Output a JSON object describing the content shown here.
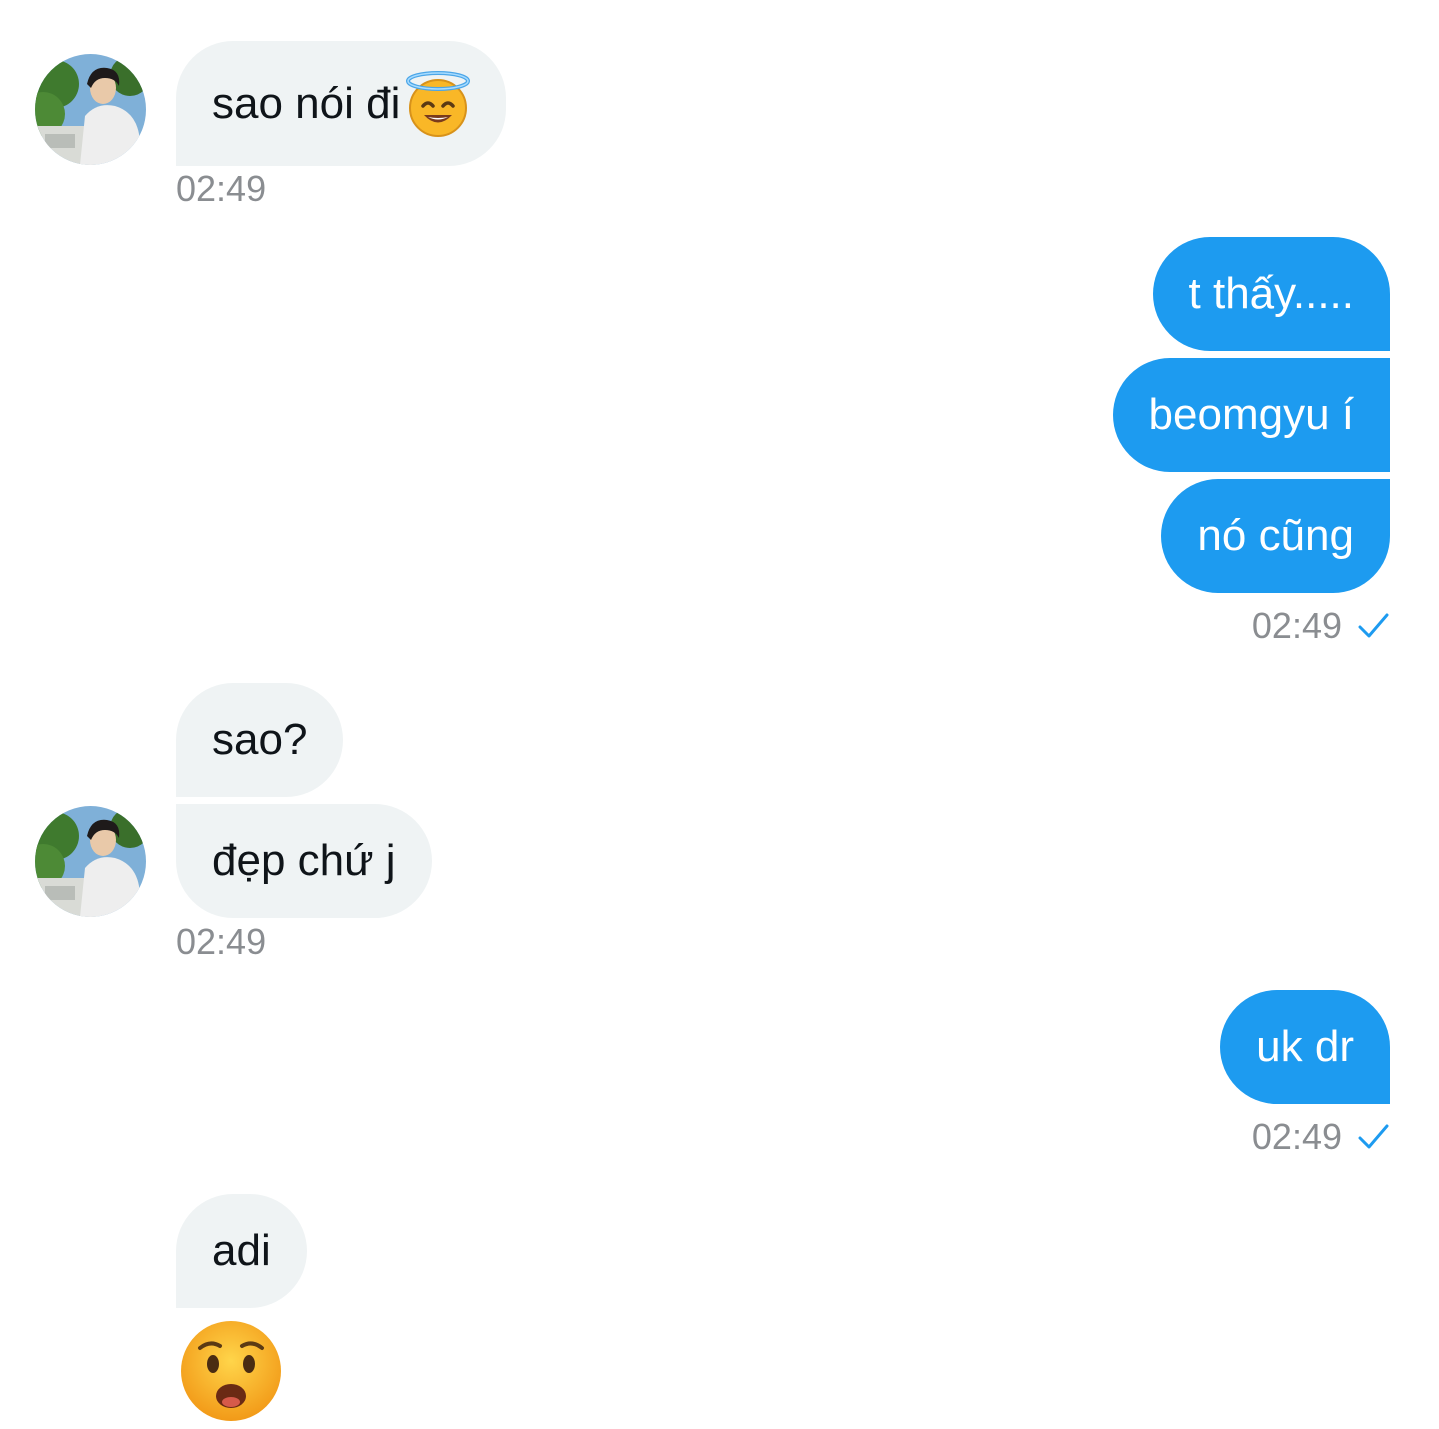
{
  "conversation": {
    "messages": [
      {
        "text": "sao nói đi",
        "emoji": "smiling-face-with-halo"
      },
      {
        "text": "t thấy....."
      },
      {
        "text": "beomgyu í"
      },
      {
        "text": "nó cũng"
      },
      {
        "text": "sao?"
      },
      {
        "text": "đẹp chứ j"
      },
      {
        "text": "uk dr"
      },
      {
        "text": "adi"
      }
    ],
    "timestamps": [
      "02:49",
      "02:49",
      "02:49",
      "02:49"
    ],
    "trailing_emoji": "anguished-face",
    "colors": {
      "sent_bubble": "#1d9bf0",
      "received_bubble": "#eff3f4",
      "timestamp": "#8a8d91",
      "read_check": "#1d9bf0"
    }
  }
}
